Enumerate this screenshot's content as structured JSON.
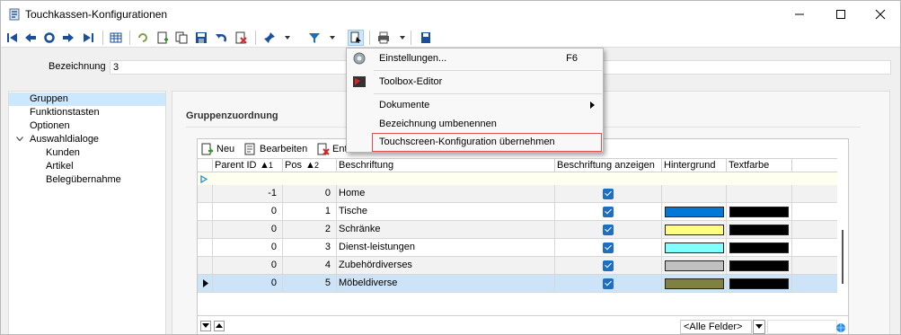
{
  "window": {
    "title": "Touchkassen-Konfigurationen"
  },
  "form": {
    "bezeichnung_label": "Bezeichnung",
    "bezeichnung_value": "3"
  },
  "tree": {
    "items": [
      {
        "label": "Gruppen",
        "level": 1,
        "selected": true
      },
      {
        "label": "Funktionstasten",
        "level": 1
      },
      {
        "label": "Optionen",
        "level": 1
      },
      {
        "label": "Auswahldialoge",
        "level": 1,
        "expanded": true
      },
      {
        "label": "Kunden",
        "level": 2
      },
      {
        "label": "Artikel",
        "level": 2
      },
      {
        "label": "Belegübernahme",
        "level": 2
      }
    ]
  },
  "group": {
    "title": "Gruppenzuordnung"
  },
  "grid_toolbar": {
    "new_label": "Neu",
    "edit_label": "Bearbeiten",
    "delete_label": "Ent"
  },
  "grid": {
    "columns": [
      "Parent ID",
      "Pos",
      "Beschriftung",
      "Beschriftung anzeigen",
      "Hintergrund",
      "Textfarbe"
    ],
    "sort_markers": {
      "parent_id": "1",
      "pos": "2"
    },
    "rows": [
      {
        "parent_id": "-1",
        "pos": "0",
        "label": "Home",
        "show": true,
        "bg": "",
        "fg": ""
      },
      {
        "parent_id": "0",
        "pos": "1",
        "label": "Tische",
        "show": true,
        "bg": "#0078d7",
        "fg": "#000000"
      },
      {
        "parent_id": "0",
        "pos": "2",
        "label": "Schränke",
        "show": true,
        "bg": "#ffff80",
        "fg": "#000000"
      },
      {
        "parent_id": "0",
        "pos": "3",
        "label": "Dienst-leistungen",
        "show": true,
        "bg": "#80ffff",
        "fg": "#000000"
      },
      {
        "parent_id": "0",
        "pos": "4",
        "label": "Zubehördiverses",
        "show": true,
        "bg": "#c0c0c0",
        "fg": "#000000"
      },
      {
        "parent_id": "0",
        "pos": "5",
        "label": "Möbeldiverse",
        "show": true,
        "bg": "#808040",
        "fg": "#000000"
      }
    ],
    "selected_row": 5,
    "footer_select": "<Alle Felder>"
  },
  "context_menu": {
    "items": [
      {
        "label": "Einstellungen...",
        "shortcut": "F6",
        "icon": "gear-icon"
      },
      {
        "label": "Toolbox-Editor",
        "shortcut": "",
        "icon": "toolbox-icon"
      },
      {
        "label": "Dokumente",
        "shortcut": "",
        "submenu": true
      },
      {
        "label": "Bezeichnung umbenennen",
        "shortcut": ""
      },
      {
        "label": "Touchscreen-Konfiguration übernehmen",
        "shortcut": "",
        "highlighted": true
      }
    ]
  },
  "colors": {
    "accent": "#1e6fc1",
    "selection": "#cce8ff",
    "highlight_border": "#e05050"
  }
}
